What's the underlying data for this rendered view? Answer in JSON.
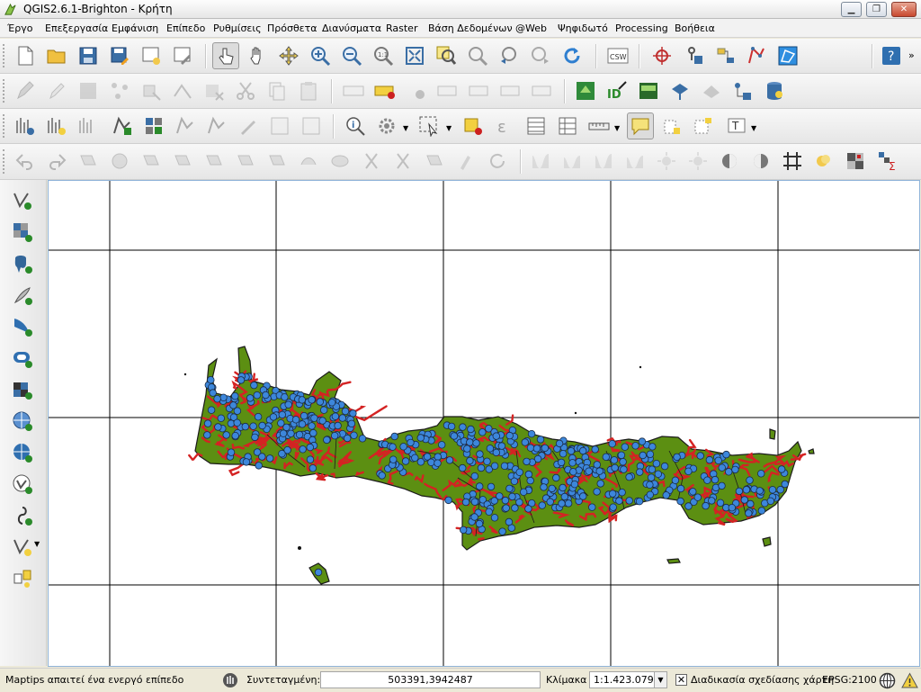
{
  "window": {
    "title": "QGIS2.6.1-Brighton - Κρήτη",
    "buttons": {
      "minimize": "▁",
      "maximize": "❐",
      "close": "✕"
    }
  },
  "menu": [
    "Έργο",
    "Επεξεργασία",
    "Εμφάνιση",
    "Επίπεδο",
    "Ρυθμίσεις",
    "Πρόσθετα",
    "Διανύσματα",
    "Raster",
    "Βάση Δεδομένων",
    "@Web",
    "Ψηφιδωτό",
    "Processing",
    "Βοήθεια"
  ],
  "toolbars": {
    "row1_icons": [
      "new-project-icon",
      "open-project-icon",
      "save-project-icon",
      "save-as-icon",
      "new-print-composer-icon",
      "composer-manager-icon",
      "touch-icon",
      "pan-icon",
      "pan-to-selection-icon",
      "zoom-in-icon",
      "zoom-out-icon",
      "zoom-actual-icon",
      "zoom-full-icon",
      "zoom-to-selection-icon",
      "zoom-to-layer-icon",
      "zoom-last-icon",
      "zoom-next-icon",
      "refresh-icon",
      "csw-icon",
      "crosshair-icon",
      "gps-icon",
      "plugin-icon",
      "vector-digitize-icon",
      "georeference-icon",
      "help-icon"
    ],
    "row1_csw_label": "CSW",
    "row2_icons": [
      "current-edits-icon",
      "toggle-editing-icon",
      "save-edits-icon",
      "add-feature-icon",
      "move-feature-icon",
      "node-tool-icon",
      "delete-selected-icon",
      "cut-features-icon",
      "copy-features-icon",
      "paste-features-icon",
      "label-icon",
      "label-pin-icon",
      "label-show-hide-icon",
      "label-move-icon",
      "label-rotate-icon",
      "label-change-icon",
      "gpx-icon",
      "virtual-layer-icon",
      "terrain-icon",
      "spatial-bookmark-icon",
      "layer-import-icon",
      "db-manager-icon"
    ],
    "row3_icons": [
      "add-raster-icon",
      "add-vector-icon",
      "new-shapefile-icon",
      "identify-icon",
      "run-action-icon",
      "select-icon",
      "deselect-icon",
      "expression-icon",
      "attribute-table-icon",
      "statistics-icon",
      "measure-icon",
      "map-tips-icon",
      "new-bookmark-icon",
      "show-bookmarks-icon",
      "text-annotation-icon"
    ],
    "row4_icons": [
      "undo-icon",
      "redo-icon",
      "rotate-feature-icon",
      "simplify-icon",
      "add-ring-icon",
      "add-part-icon",
      "fill-ring-icon",
      "delete-ring-icon",
      "delete-part-icon",
      "reshape-icon",
      "offset-curve-icon",
      "split-features-icon",
      "split-parts-icon",
      "merge-features-icon",
      "merge-attributes-icon",
      "rotate-point-symbols-icon",
      "raster-histogram-icon",
      "raster-stretch-icon",
      "raster-local-icon",
      "raster-full-icon",
      "brightness-icon",
      "contrast-icon",
      "grid-icon",
      "heatmap-icon",
      "zonal-stats-icon"
    ],
    "left_icons": [
      "add-vector-layer-icon",
      "add-raster-layer-icon",
      "add-postgis-icon",
      "add-spatialite-icon",
      "add-mssql-icon",
      "add-oracle-icon",
      "add-db2-icon",
      "add-wms-icon",
      "add-wcs-icon",
      "add-wfs-icon",
      "add-delimited-text-icon",
      "new-vector-layer-icon",
      "new-memory-layer-icon"
    ]
  },
  "map": {
    "background": "#ffffff",
    "land_color": "#5c8f12",
    "road_color": "#d42323",
    "point_color": "#3d87db",
    "border_color": "#1b1b1b",
    "grid_color": "#000000"
  },
  "status": {
    "message": "Maptips απαιτεί ένα ενεργό επίπεδο",
    "coordinate_label": "Συντεταγμένη:",
    "coordinate_value": "503391,3942487",
    "scale_label": "Κλίμακα",
    "scale_value": "1:1.423.079",
    "render_label": "Διαδικασία σχεδίασης χάρτη",
    "epsg": "EPSG:2100"
  }
}
